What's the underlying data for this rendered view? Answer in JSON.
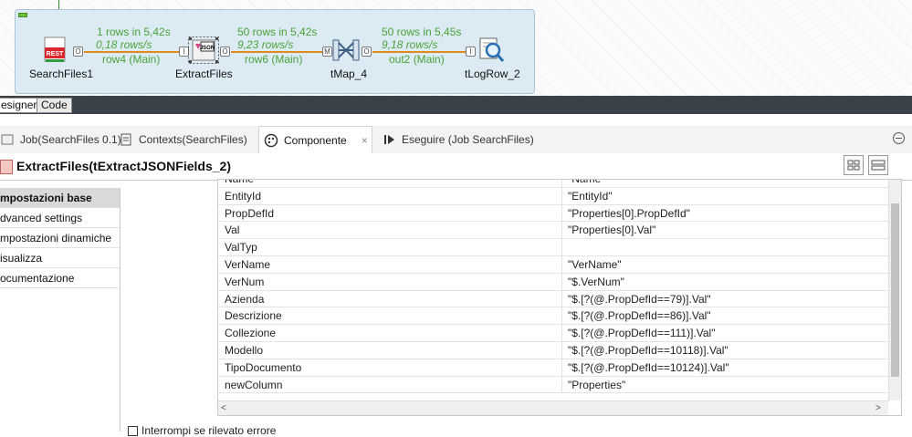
{
  "job_canvas": {
    "components": [
      {
        "name": "SearchFiles1",
        "icon": "rest-icon"
      },
      {
        "name": "ExtractFiles",
        "icon": "json-extract-icon"
      },
      {
        "name": "tMap_4",
        "icon": "tmap-icon"
      },
      {
        "name": "tLogRow_2",
        "icon": "magnifier-log-icon"
      }
    ],
    "links": [
      {
        "stat_rows": "1 rows in 5,42s",
        "stat_rate": "0,18 rows/s",
        "label": "row4 (Main)"
      },
      {
        "stat_rows": "50 rows in 5,42s",
        "stat_rate": "9,23 rows/s",
        "label": "row6 (Main)"
      },
      {
        "stat_rows": "50 rows in 5,45s",
        "stat_rate": "9,18 rows/s",
        "label": "out2 (Main)"
      }
    ],
    "connector_letters": {
      "out1": "O",
      "in1": "I",
      "out2": "O",
      "in2": "M",
      "out3": "O",
      "in3": "I"
    }
  },
  "designer_tabs": [
    {
      "label": "esigner"
    },
    {
      "label": "Code"
    }
  ],
  "view_tabs": [
    {
      "label": "Job(SearchFiles 0.1)",
      "icon": "job-icon"
    },
    {
      "label": "Contexts(SearchFiles)",
      "icon": "contexts-icon"
    },
    {
      "label": "Componente",
      "icon": "component-palette-icon",
      "active": true
    },
    {
      "label": "Eseguire (Job SearchFiles)",
      "icon": "run-icon"
    }
  ],
  "component_title": "ExtractFiles(tExtractJSONFields_2)",
  "left_nav": [
    {
      "label": "mpostazioni base",
      "active": true
    },
    {
      "label": "dvanced settings"
    },
    {
      "label": "mpostazioni dinamiche"
    },
    {
      "label": "isualizza"
    },
    {
      "label": "ocumentazione"
    }
  ],
  "mapping_table": {
    "rows": [
      {
        "column": "Name",
        "query": "\"Name\""
      },
      {
        "column": "EntityId",
        "query": "\"EntityId\""
      },
      {
        "column": "PropDefId",
        "query": "\"Properties[0].PropDefId\""
      },
      {
        "column": "Val",
        "query": "\"Properties[0].Val\""
      },
      {
        "column": "ValTyp",
        "query": ""
      },
      {
        "column": "VerName",
        "query": "\"VerName\""
      },
      {
        "column": "VerNum",
        "query": "\"$.VerNum\""
      },
      {
        "column": "Azienda",
        "query": "\"$.[?(@.PropDefId==79)].Val\""
      },
      {
        "column": "Descrizione",
        "query": "\"$.[?(@.PropDefId==86)].Val\""
      },
      {
        "column": "Collezione",
        "query": "\"$.[?(@.PropDefId==111)].Val\""
      },
      {
        "column": "Modello",
        "query": "\"$.[?(@.PropDefId==10118)].Val\""
      },
      {
        "column": "TipoDocumento",
        "query": "\"$.[?(@.PropDefId==10124)].Val\""
      },
      {
        "column": "newColumn",
        "query": "\"Properties\""
      }
    ]
  },
  "checkbox_label": "Interrompi se rilevato errore",
  "colors": {
    "accent_green": "#4aa33a",
    "link_orange": "#e08a1e",
    "dark_strip": "#3b4149"
  }
}
